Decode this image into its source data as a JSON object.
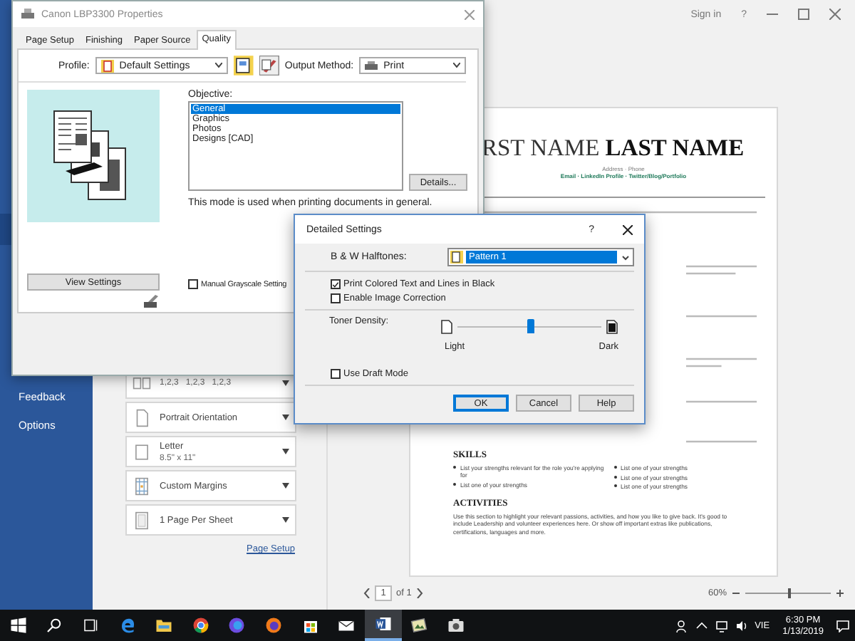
{
  "word_window": {
    "top_bar": {
      "sign_in": "Sign in",
      "help": "?"
    },
    "sidebar": {
      "items": [
        {
          "label": "Feedback"
        },
        {
          "label": "Options"
        }
      ]
    },
    "print_settings": [
      {
        "kind": "collate",
        "detail": "1,2,3   1,2,3   1,2,3"
      },
      {
        "kind": "orientation",
        "title": "Portrait Orientation"
      },
      {
        "kind": "paper",
        "title": "Letter",
        "detail": "8.5\" x 11\""
      },
      {
        "kind": "margins",
        "title": "Custom Margins"
      },
      {
        "kind": "pages",
        "title": "1 Page Per Sheet"
      }
    ],
    "page_setup_link": "Page Setup",
    "preview": {
      "name": "RST NAME **LAST NAME**",
      "contact": "Address · Phone",
      "links": "Email · LinkedIn Profile · Twitter/Blog/Portfolio",
      "skills_heading": "SKILLS",
      "skills_left": [
        "List your strengths relevant for the role you're applying for",
        "List one of your strengths"
      ],
      "skills_right": [
        "List one of your strengths",
        "List one of your strengths",
        "List one of your strengths"
      ],
      "activities_heading": "ACTIVITIES",
      "activities_text": "Use this section to highlight your relevant passions, activities, and how you like to give back. It's good to include Leadership and volunteer experiences here. Or show off important extras like publications, certifications, languages and more."
    },
    "page_nav": {
      "page": "1",
      "total": "of 1"
    },
    "zoom": {
      "percent": "60%",
      "level": 0.5
    }
  },
  "properties_dialog": {
    "title": "Canon LBP3300 Properties",
    "tabs": [
      {
        "label": "Page Setup",
        "selected": false
      },
      {
        "label": "Finishing",
        "selected": false
      },
      {
        "label": "Paper Source",
        "selected": false
      },
      {
        "label": "Quality",
        "selected": true
      }
    ],
    "profile_label": "Profile:",
    "profile_value": "Default Settings",
    "output_label": "Output Method:",
    "output_value": "Print",
    "objective_label": "Objective:",
    "objectives": [
      {
        "label": "General",
        "selected": true
      },
      {
        "label": "Graphics",
        "selected": false
      },
      {
        "label": "Photos",
        "selected": false
      },
      {
        "label": "Designs [CAD]",
        "selected": false
      }
    ],
    "details_button": "Details...",
    "description": "This mode is used when printing documents in general.",
    "view_settings_button": "View Settings",
    "manual_grayscale": {
      "label": "Manual Grayscale Setting",
      "checked": false
    }
  },
  "detailed_settings_dialog": {
    "title": "Detailed Settings",
    "help": "?",
    "halftones_label": "B & W Halftones:",
    "halftones_value": "Pattern 1",
    "options": [
      {
        "label": "Print Colored Text and Lines in Black",
        "checked": true
      },
      {
        "label": "Enable Image Correction",
        "checked": false
      }
    ],
    "toner_label": "Toner Density:",
    "toner": {
      "level": 0.5,
      "min_label": "Light",
      "max_label": "Dark"
    },
    "draft_mode": {
      "label": "Use Draft Mode",
      "checked": false
    },
    "buttons": [
      {
        "label": "OK",
        "kind": "default"
      },
      {
        "label": "Cancel",
        "kind": "normal"
      },
      {
        "label": "Help",
        "kind": "normal"
      }
    ]
  },
  "taskbar": {
    "apps": [
      {
        "kind": "start",
        "selected": false
      },
      {
        "kind": "search",
        "selected": false
      },
      {
        "kind": "taskview",
        "selected": false
      },
      {
        "kind": "edge",
        "selected": false
      },
      {
        "kind": "folder",
        "selected": false
      },
      {
        "kind": "chrome",
        "selected": false
      },
      {
        "kind": "firefoxblue",
        "selected": false
      },
      {
        "kind": "firefox",
        "selected": false
      },
      {
        "kind": "store",
        "selected": false
      },
      {
        "kind": "mail",
        "selected": false
      },
      {
        "kind": "word",
        "selected": true
      },
      {
        "kind": "photo",
        "selected": false
      },
      {
        "kind": "camera",
        "selected": false
      }
    ],
    "tray": {
      "language": "VIE",
      "time": "6:30 PM",
      "date": "1/13/2019"
    }
  }
}
